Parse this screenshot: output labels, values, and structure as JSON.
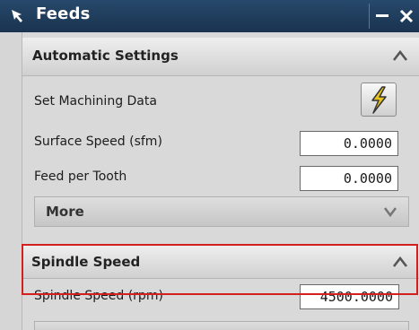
{
  "window": {
    "title": "Feeds"
  },
  "automatic_settings": {
    "title": "Automatic Settings",
    "set_machining_data_label": "Set Machining Data",
    "surface_speed_label": "Surface Speed (sfm)",
    "surface_speed_value": "0.0000",
    "feed_per_tooth_label": "Feed per Tooth",
    "feed_per_tooth_value": "0.0000",
    "more_label": "More"
  },
  "spindle_speed": {
    "title": "Spindle Speed",
    "rpm_label": "Spindle Speed (rpm)",
    "rpm_value": "4500.0000"
  },
  "colors": {
    "title_bar": "#1f3d5c",
    "highlight": "#d41f1f",
    "lightning": "#e8c21c"
  },
  "icons": [
    "select-arrow-icon",
    "minimize-icon",
    "close-icon",
    "chevron-up-icon",
    "chevron-down-icon",
    "lightning-icon"
  ]
}
